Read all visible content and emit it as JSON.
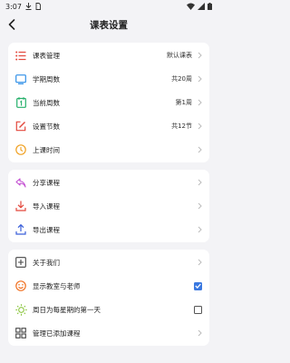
{
  "status_bar": {
    "time": "3:07"
  },
  "header": {
    "title": "课表设置"
  },
  "groups": [
    {
      "items": [
        {
          "label": "课表管理",
          "value": "默认课表",
          "icon": "list-icon",
          "color": "#e3483c"
        },
        {
          "label": "学期周数",
          "value": "共20周",
          "icon": "monitor-icon",
          "color": "#2f8fe8"
        },
        {
          "label": "当前周数",
          "value": "第1周",
          "icon": "calendar-number-icon",
          "color": "#26b06b"
        },
        {
          "label": "设置节数",
          "value": "共12节",
          "icon": "edit-square-icon",
          "color": "#e3483c"
        },
        {
          "label": "上课时间",
          "value": "",
          "icon": "clock-icon",
          "color": "#f0a020"
        }
      ]
    },
    {
      "items": [
        {
          "label": "分享课程",
          "icon": "share-icon",
          "color": "#c24bd1"
        },
        {
          "label": "导入课程",
          "icon": "import-icon",
          "color": "#e3483c"
        },
        {
          "label": "导出课程",
          "icon": "export-icon",
          "color": "#3a5fd9"
        }
      ]
    },
    {
      "items": [
        {
          "label": "关于我们",
          "icon": "plus-square-icon",
          "color": "#444444"
        },
        {
          "label": "显示教室与老师",
          "icon": "smile-icon",
          "color": "#f07020",
          "checked": true
        },
        {
          "label": "周日为每星期的第一天",
          "icon": "sun-icon",
          "color": "#8cc63f",
          "checked": false
        },
        {
          "label": "管理已添加课程",
          "icon": "grid-icon",
          "color": "#444444"
        }
      ]
    }
  ],
  "accent": "#3a78e0"
}
